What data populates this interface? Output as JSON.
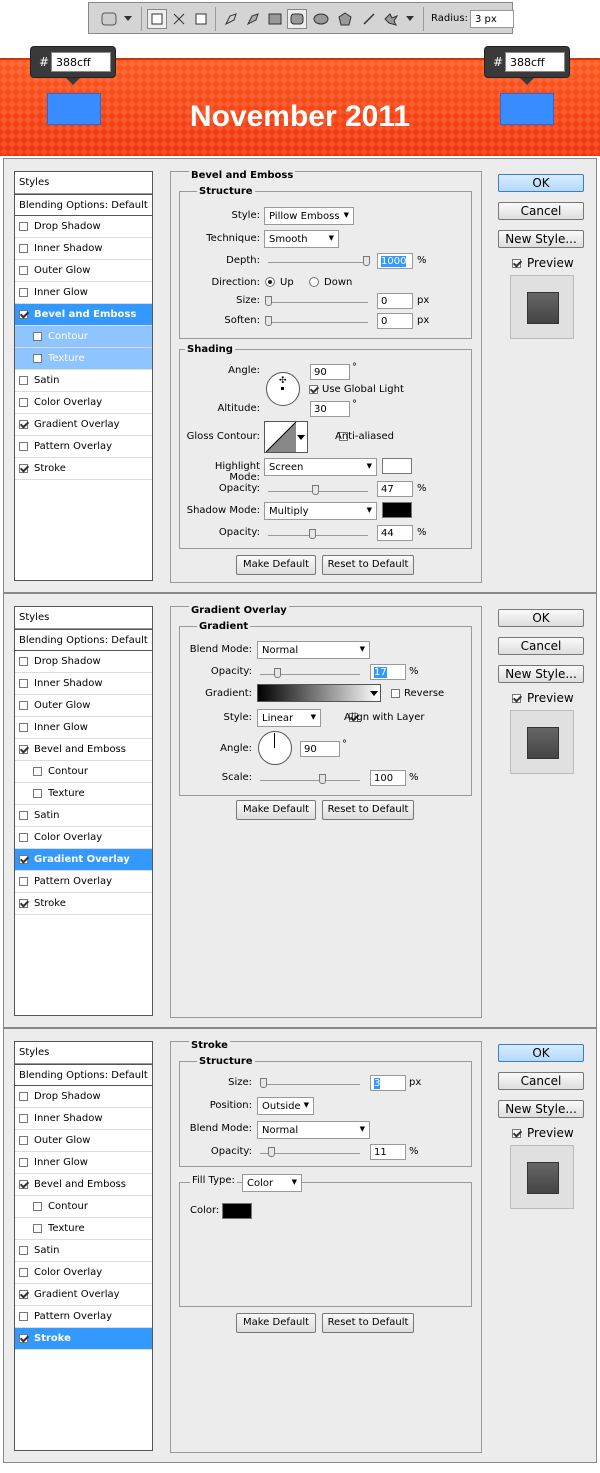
{
  "toolbar": {
    "radius_label": "Radius:",
    "radius_value": "3 px"
  },
  "banner": {
    "title": "November 2011",
    "hash": "#",
    "color_value": "388cff",
    "box_color": "#388cff"
  },
  "dialogs": [
    {
      "styles_title": "Styles",
      "blending": "Blending Options: Default",
      "items": [
        {
          "label": "Drop Shadow",
          "checked": false
        },
        {
          "label": "Inner Shadow",
          "checked": false
        },
        {
          "label": "Outer Glow",
          "checked": false
        },
        {
          "label": "Inner Glow",
          "checked": false
        },
        {
          "label": "Bevel and Emboss",
          "checked": true
        },
        {
          "label": "Contour",
          "checked": false
        },
        {
          "label": "Texture",
          "checked": false
        },
        {
          "label": "Satin",
          "checked": false
        },
        {
          "label": "Color Overlay",
          "checked": false
        },
        {
          "label": "Gradient Overlay",
          "checked": true
        },
        {
          "label": "Pattern Overlay",
          "checked": false
        },
        {
          "label": "Stroke",
          "checked": true
        }
      ],
      "ok": "OK",
      "cancel": "Cancel",
      "new_style": "New Style...",
      "preview": "Preview",
      "make_default": "Make Default",
      "reset_default": "Reset to Default"
    }
  ],
  "bevel": {
    "title": "Bevel and Emboss",
    "structure": "Structure",
    "style_label": "Style:",
    "style_value": "Pillow Emboss",
    "technique_label": "Technique:",
    "technique_value": "Smooth",
    "depth_label": "Depth:",
    "depth_value": "1000",
    "depth_unit": "%",
    "direction_label": "Direction:",
    "up": "Up",
    "down": "Down",
    "size_label": "Size:",
    "size_value": "0",
    "size_unit": "px",
    "soften_label": "Soften:",
    "soften_value": "0",
    "soften_unit": "px",
    "shading": "Shading",
    "angle_label": "Angle:",
    "angle_value": "90",
    "deg": "°",
    "global_light": "Use Global Light",
    "altitude_label": "Altitude:",
    "altitude_value": "30",
    "gloss_label": "Gloss Contour:",
    "anti_aliased": "Anti-aliased",
    "highlight_label": "Highlight Mode:",
    "highlight_value": "Screen",
    "h_opacity_label": "Opacity:",
    "h_opacity_value": "47",
    "pct": "%",
    "shadow_label": "Shadow Mode:",
    "shadow_value": "Multiply",
    "s_opacity_label": "Opacity:",
    "s_opacity_value": "44"
  },
  "gradient": {
    "title": "Gradient Overlay",
    "group": "Gradient",
    "blend_label": "Blend Mode:",
    "blend_value": "Normal",
    "opacity_label": "Opacity:",
    "opacity_value": "17",
    "pct": "%",
    "gradient_label": "Gradient:",
    "reverse": "Reverse",
    "style_label": "Style:",
    "style_value": "Linear",
    "align": "Align with Layer",
    "angle_label": "Angle:",
    "angle_value": "90",
    "deg": "°",
    "scale_label": "Scale:",
    "scale_value": "100"
  },
  "stroke": {
    "title": "Stroke",
    "structure": "Structure",
    "size_label": "Size:",
    "size_value": "3",
    "size_unit": "px",
    "position_label": "Position:",
    "position_value": "Outside",
    "blend_label": "Blend Mode:",
    "blend_value": "Normal",
    "opacity_label": "Opacity:",
    "opacity_value": "11",
    "pct": "%",
    "fill_label": "Fill Type:",
    "fill_value": "Color",
    "color_label": "Color:"
  }
}
